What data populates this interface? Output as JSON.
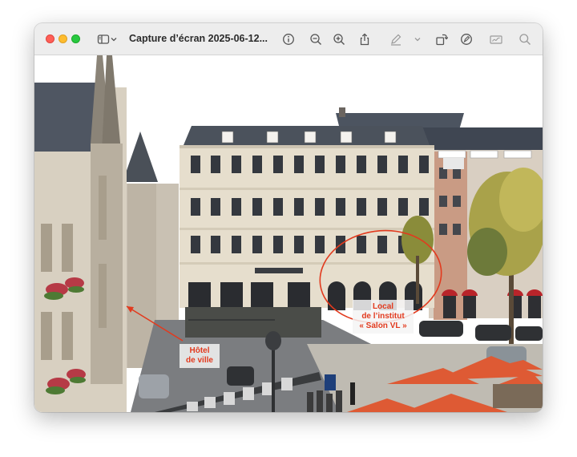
{
  "window": {
    "title": "Capture d’écran 2025-06-12...",
    "toolbar_icons": [
      "sidebar-toggle-icon",
      "chevron-down-icon",
      "info-icon",
      "zoom-out-icon",
      "zoom-in-icon",
      "share-icon",
      "markup-pen-icon",
      "chevron-down-icon",
      "rotate-icon",
      "markup-icon",
      "signature-icon",
      "search-icon"
    ]
  },
  "photo": {
    "annotations": {
      "local": "Local\nde l’institut\n« Salon VL »",
      "hotel": "Hôtel\nde ville"
    },
    "accent_color": "#e23a1e"
  }
}
